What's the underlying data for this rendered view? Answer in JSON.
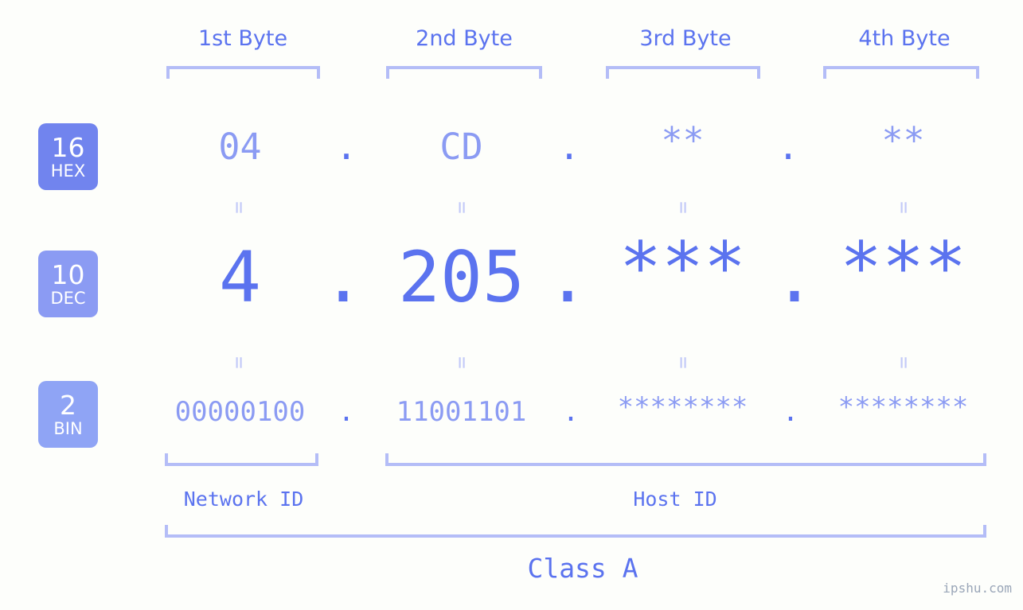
{
  "meta": {
    "background": "#fdfefb",
    "accent": "#5b73ef",
    "accent_light": "#8b9bf3",
    "bracket_color": "#b4bdf7",
    "watermark": "ipshu.com"
  },
  "headers": [
    {
      "label": "1st Byte"
    },
    {
      "label": "2nd Byte"
    },
    {
      "label": "3rd Byte"
    },
    {
      "label": "4th Byte"
    }
  ],
  "bases": [
    {
      "num": "16",
      "abbr": "HEX",
      "color": "#7184ee"
    },
    {
      "num": "10",
      "abbr": "DEC",
      "color": "#8b9bf3"
    },
    {
      "num": "2",
      "abbr": "BIN",
      "color": "#8fa4f5"
    }
  ],
  "rows": {
    "hex": {
      "base_num": "16",
      "base_abbr": "HEX",
      "values": [
        "04",
        "CD",
        "**",
        "**"
      ],
      "separator": "."
    },
    "dec": {
      "base_num": "10",
      "base_abbr": "DEC",
      "values": [
        "4",
        "205",
        "***",
        "***"
      ],
      "separator": "."
    },
    "bin": {
      "base_num": "2",
      "base_abbr": "BIN",
      "values": [
        "00000100",
        "11001101",
        "********",
        "********"
      ],
      "separator": "."
    }
  },
  "equals": {
    "symbol": "=",
    "hex_dec": [
      "=",
      "=",
      "=",
      "="
    ],
    "dec_bin": [
      "=",
      "=",
      "=",
      "="
    ]
  },
  "segments": {
    "network_id": "Network ID",
    "host_id": "Host ID",
    "class": "Class A"
  }
}
